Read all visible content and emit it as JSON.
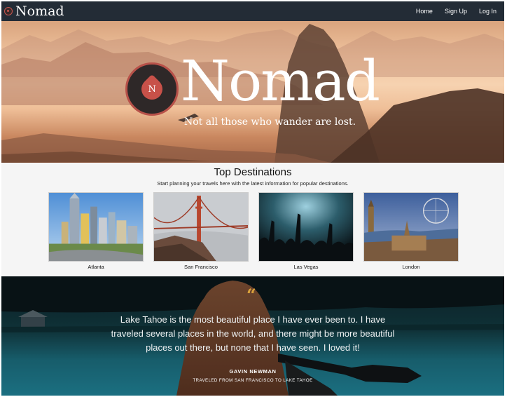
{
  "navbar": {
    "brand": "Nomad",
    "links": [
      "Home",
      "Sign Up",
      "Log In"
    ]
  },
  "hero": {
    "logo_letter": "N",
    "title": "Nomad",
    "tagline": "Not all those who wander are lost."
  },
  "destinations": {
    "title": "Top Destinations",
    "subtitle": "Start planning your travels here with the latest information for popular destinations.",
    "items": [
      {
        "name": "Atlanta"
      },
      {
        "name": "San Francisco"
      },
      {
        "name": "Las Vegas"
      },
      {
        "name": "London"
      }
    ]
  },
  "testimonial": {
    "quote_icon": "quote-icon",
    "quote": "Lake Tahoe is the most beautiful place I have ever been to. I have traveled several places in the world, and there might be more beautiful places out there, but none that I have seen. I loved it!",
    "author": "GAVIN NEWMAN",
    "author_detail": "TRAVELED FROM SAN FRANCISCO TO LAKE TAHOE"
  },
  "colors": {
    "navbar": "#232c36",
    "accent": "#c85149",
    "quote_mark": "#d9a13b"
  }
}
